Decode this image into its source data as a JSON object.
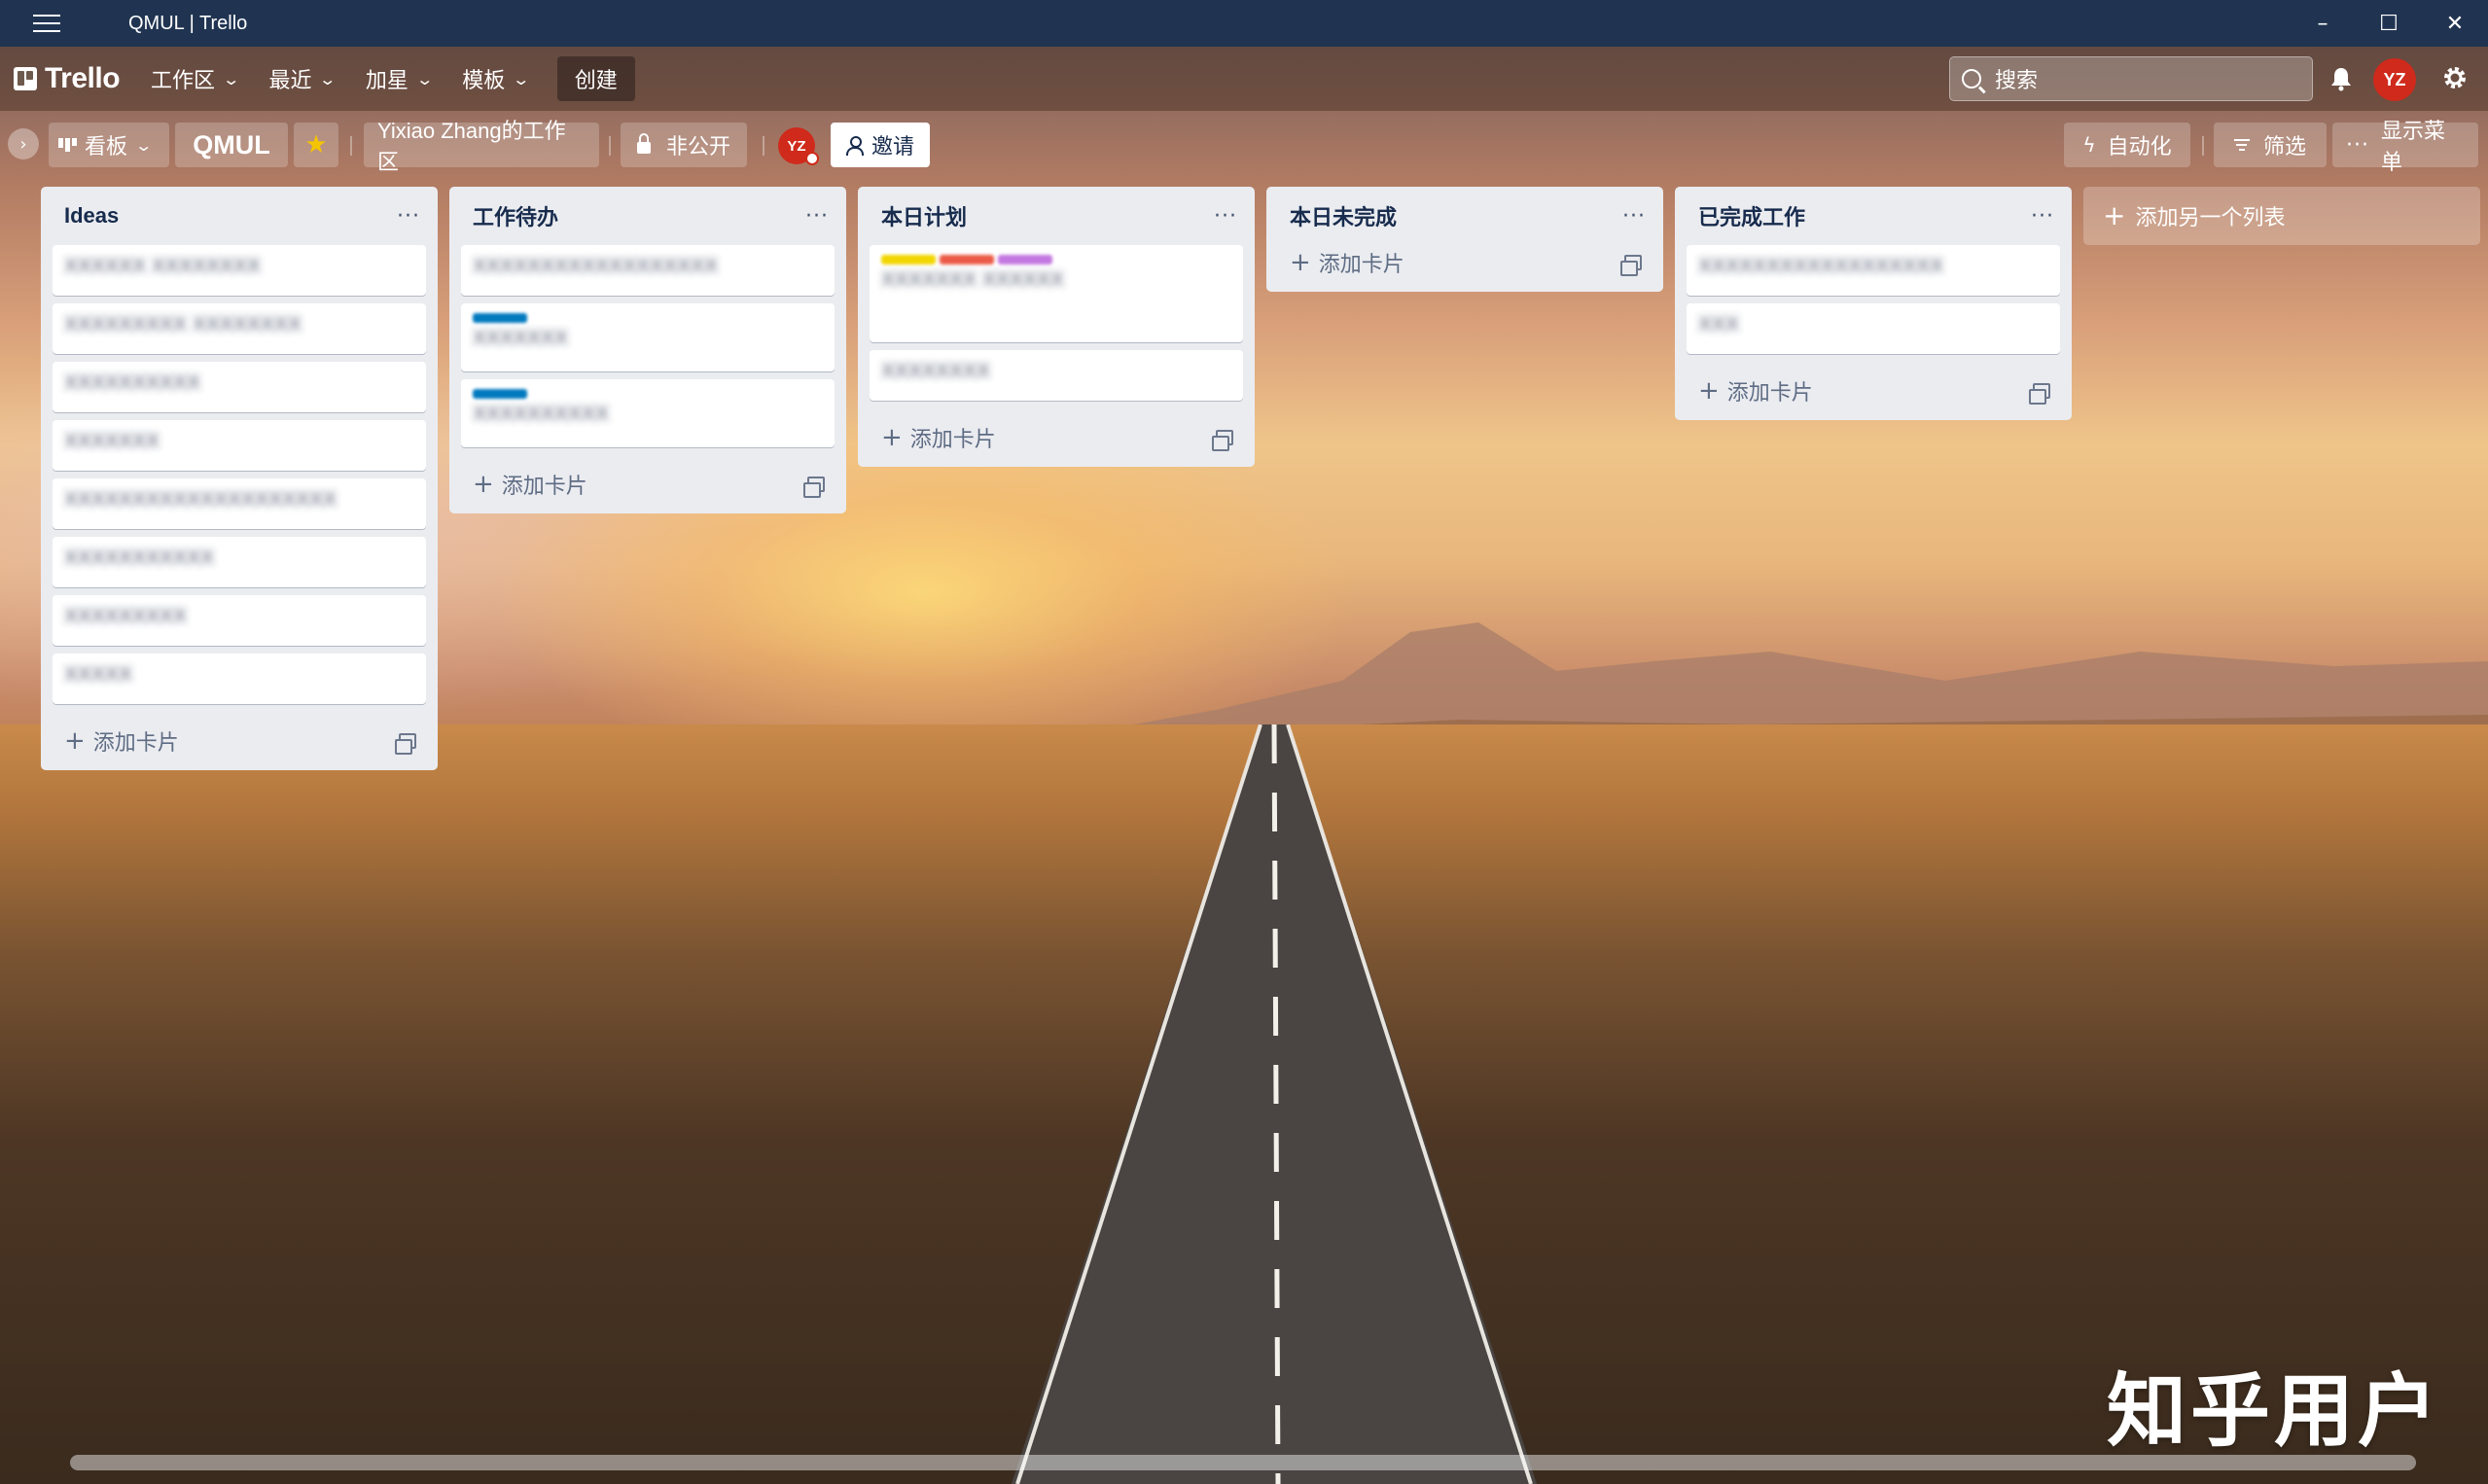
{
  "window": {
    "title": "QMUL | Trello",
    "controls": [
      "–",
      "☐",
      "✕"
    ]
  },
  "header": {
    "logo": "Trello",
    "nav": [
      {
        "label": "工作区"
      },
      {
        "label": "最近"
      },
      {
        "label": "加星"
      },
      {
        "label": "模板"
      }
    ],
    "create_label": "创建",
    "search_placeholder": "搜索",
    "avatar_initials": "YZ"
  },
  "board": {
    "view_label": "看板",
    "name": "QMUL",
    "workspace": "Yixiao Zhang的工作区",
    "visibility": "非公开",
    "member_initials": "YZ",
    "invite_label": "邀请",
    "automation_label": "自动化",
    "filter_label": "筛选",
    "menu_label": "显示菜单"
  },
  "lists": [
    {
      "title": "Ideas",
      "cards": [
        {
          "text": "XXXXXX XXXXXXXX"
        },
        {
          "text": "XXXXXXXXX XXXXXXXX"
        },
        {
          "text": "XXXXXXXXXX"
        },
        {
          "text": "XXXXXXX"
        },
        {
          "text": "XXXXXXXXXXXXXXXXXXXX"
        },
        {
          "text": "XXXXXXXXXXX"
        },
        {
          "text": "XXXXXXXXX"
        },
        {
          "text": "XXXXX"
        }
      ],
      "add_card_label": "添加卡片"
    },
    {
      "title": "工作待办",
      "cards": [
        {
          "text": "XXXXXXXXXXXXXXXXXX"
        },
        {
          "text": "XXXXXXX",
          "labels": [
            "#0079bf"
          ]
        },
        {
          "text": "XXXXXXXXXX",
          "labels": [
            "#0079bf"
          ]
        }
      ],
      "add_card_label": "添加卡片"
    },
    {
      "title": "本日计划",
      "cards": [
        {
          "text": "XXXXXXX XXXXXX",
          "labels": [
            "#f2d600",
            "#eb5a46",
            "#c377e0"
          ]
        },
        {
          "text": "XXXXXXXX"
        }
      ],
      "add_card_label": "添加卡片"
    },
    {
      "title": "本日未完成",
      "cards": [],
      "add_card_label": "添加卡片"
    },
    {
      "title": "已完成工作",
      "cards": [
        {
          "text": "XXXXXXXXXXXXXXXXXX"
        },
        {
          "text": "XXX"
        }
      ],
      "add_card_label": "添加卡片"
    }
  ],
  "add_list_label": "添加另一个列表",
  "watermark": "知乎用户",
  "colors": {
    "titlebar": "#203451",
    "avatar": "#cf2a1b",
    "star": "#f5c400",
    "list_bg": "#ebecf0"
  }
}
